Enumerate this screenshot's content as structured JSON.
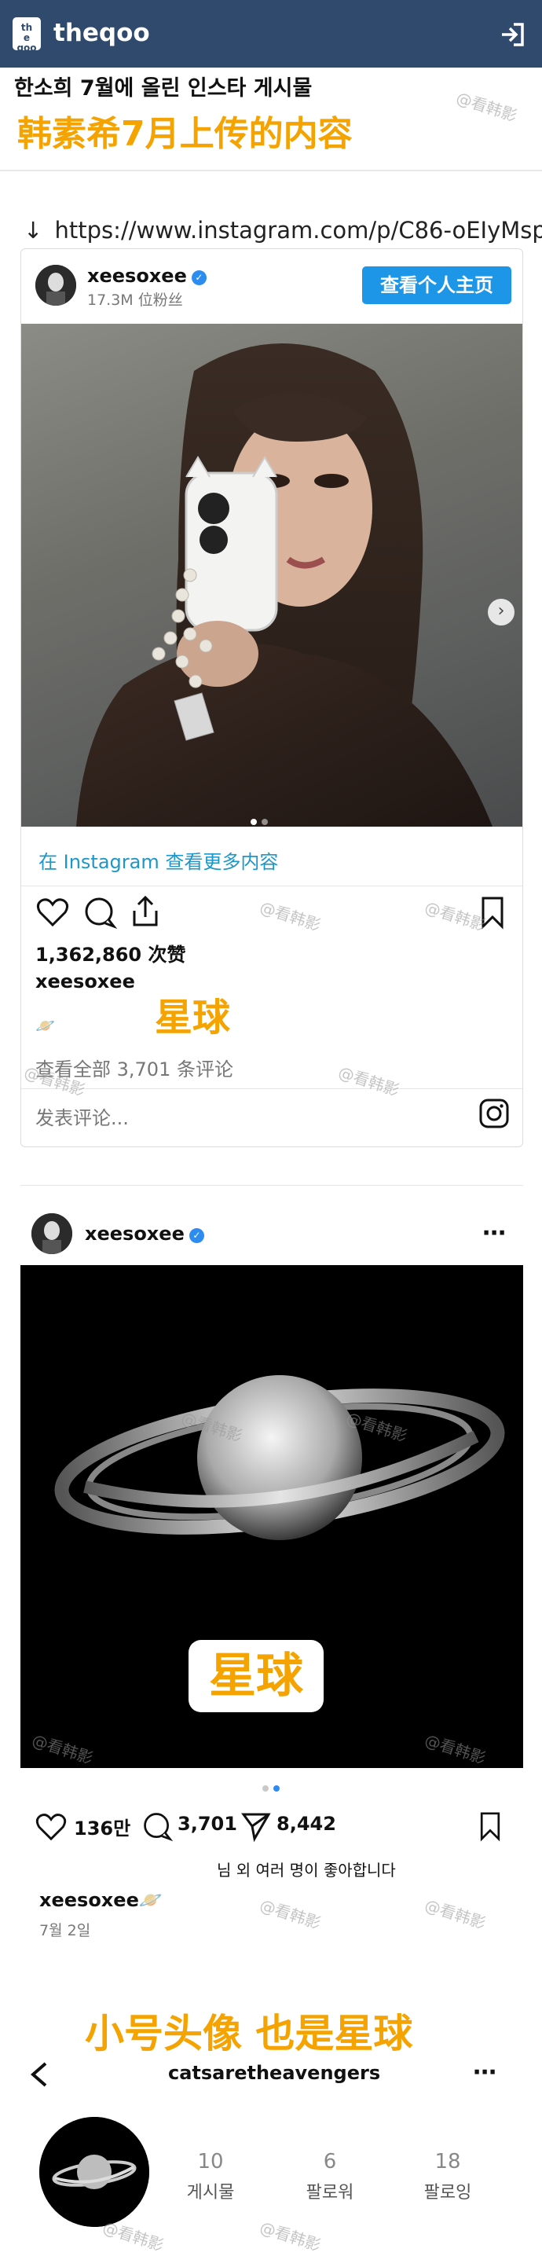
{
  "header": {
    "logo_text": "the\nqoo",
    "brand": "theqoo",
    "login_icon": "login-icon"
  },
  "article": {
    "title": "한소희 7월에 올린 인스타 게시물",
    "caption_top": "韩素希7月上传的内容",
    "url_arrow": "↓",
    "url": "https://www.instagram.com/p/C86-oEIyMsp"
  },
  "embed": {
    "username": "xeesoxee",
    "followers": "17.3M 位粉丝",
    "view_profile": "查看个人主页",
    "more_link": "在 Instagram 查看更多内容",
    "likes": "1,362,860 次赞",
    "caption_user": "xeesoxee",
    "caption_emoji": "🪐",
    "annotation": "星球",
    "comments": "查看全部 3,701 条评论",
    "comment_placeholder": "发表评论..."
  },
  "post2": {
    "username": "xeesoxee",
    "more_icon": "more-icon",
    "image_label": "星球",
    "likes": "136만",
    "comments": "3,701",
    "shares": "8,442",
    "liked_by": "님 외 여러 명이 좋아합니다",
    "caption_user": "xeesoxee🪐",
    "date": "7월 2일",
    "annotation": "小号头像 也是星球"
  },
  "profile": {
    "back_icon": "back-icon",
    "username": "catsaretheavengers",
    "more_icon": "more-icon",
    "stats": [
      {
        "value": "10",
        "label": "게시물"
      },
      {
        "value": "6",
        "label": "팔로워"
      },
      {
        "value": "18",
        "label": "팔로잉"
      }
    ]
  },
  "watermark": "@看韩影",
  "colors": {
    "header_bg": "#2f4a6d",
    "annotation": "#f4a300",
    "button_blue": "#1e96e8",
    "link_blue": "#1e96c8"
  }
}
